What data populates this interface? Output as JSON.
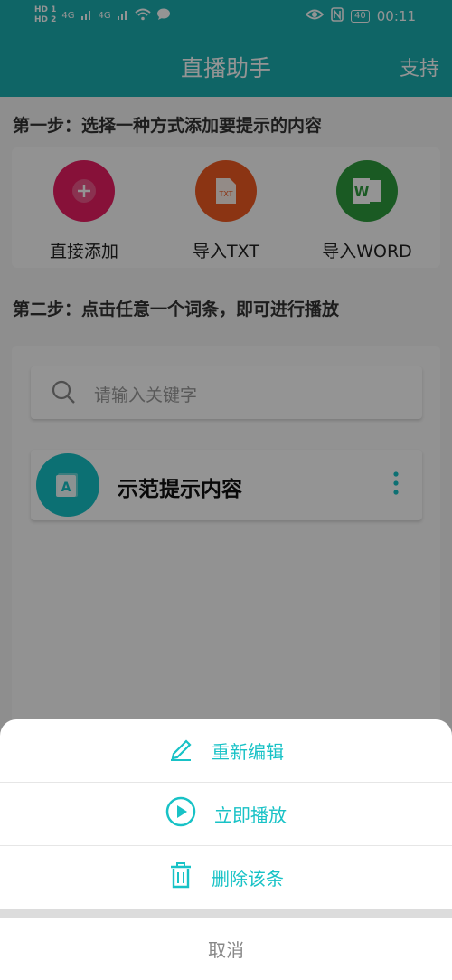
{
  "status_bar": {
    "sim1": "HD 1",
    "sim2": "HD 2",
    "network1": "4G",
    "network2": "4G",
    "battery": "40",
    "time": "00:11"
  },
  "appbar": {
    "title": "直播助手",
    "support": "支持"
  },
  "step1": {
    "text": "第一步：选择一种方式添加要提示的内容",
    "options": [
      {
        "label": "直接添加",
        "icon": "plus-icon",
        "color": "#e91e63"
      },
      {
        "label": "导入TXT",
        "icon": "txt-file-icon",
        "color": "#f05a22"
      },
      {
        "label": "导入WORD",
        "icon": "word-icon",
        "color": "#2e9b3d"
      }
    ]
  },
  "step2": {
    "text": "第二步：点击任意一个词条，即可进行播放"
  },
  "search": {
    "placeholder": "请输入关键字"
  },
  "list": {
    "items": [
      {
        "title": "示范提示内容",
        "avatar_letter": "A"
      }
    ]
  },
  "sheet": {
    "actions": [
      {
        "label": "重新编辑",
        "icon": "edit-icon"
      },
      {
        "label": "立即播放",
        "icon": "play-icon"
      },
      {
        "label": "删除该条",
        "icon": "trash-icon"
      }
    ],
    "cancel": "取消"
  },
  "colors": {
    "primary": "#1aaeb0",
    "accent": "#18c2c6"
  }
}
